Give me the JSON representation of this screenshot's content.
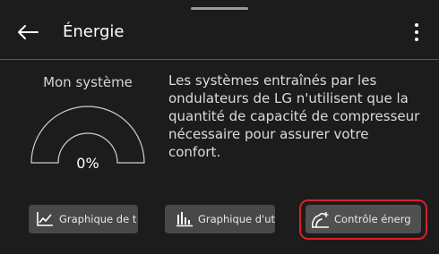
{
  "header": {
    "title": "Énergie",
    "back_icon": "arrow-left-icon",
    "menu_icon": "more-vertical-icon"
  },
  "system": {
    "label": "Mon système",
    "value": "0%",
    "fill_fraction": 0
  },
  "description": {
    "lines": [
      "Les systèmes entraînés par les",
      "ondulateurs de LG n'utilisent que la",
      "quantité de capacité de compresseur",
      "nécessaire pour assurer votre",
      "confort."
    ]
  },
  "buttons": [
    {
      "label": "Graphique de t",
      "icon": "line-chart-icon"
    },
    {
      "label": "Graphique d'ut",
      "icon": "bar-chart-icon"
    },
    {
      "label": "Contrôle énerg",
      "icon": "energy-control-icon",
      "highlighted": true
    }
  ],
  "colors": {
    "background": "#1c1c1c",
    "button": "#484848",
    "highlight": "#d8202c",
    "gauge_track": "#d0d0d0"
  }
}
